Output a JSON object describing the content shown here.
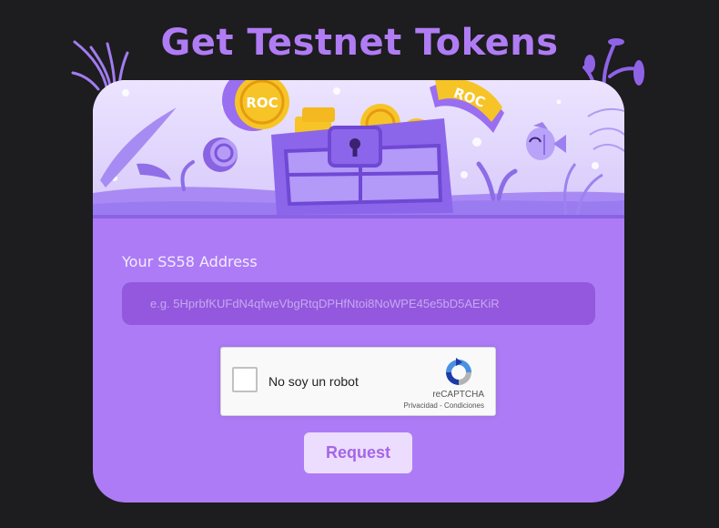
{
  "page": {
    "title": "Get Testnet Tokens"
  },
  "banner": {
    "coin_label": "ROC",
    "ribbon_label": "ROC"
  },
  "form": {
    "address_label": "Your SS58 Address",
    "address_placeholder": "e.g. 5HprbfKUFdN4qfweVbgRtqDPHfNtoi8NoWPE45e5bD5AEKiR",
    "address_value": ""
  },
  "captcha": {
    "checkbox_label": "No soy un robot",
    "brand": "reCAPTCHA",
    "privacy_link": "Privacidad",
    "separator": " - ",
    "terms_link": "Condiciones",
    "checked": false
  },
  "actions": {
    "request_label": "Request"
  },
  "colors": {
    "background": "#1d1c1f",
    "accent": "#ad7bf6",
    "title": "#b07cf4",
    "input_bg": "#9358dd",
    "button_bg": "#ecdcfd",
    "button_text": "#a466e8",
    "coin": "#f6c427"
  },
  "icons": [
    "seaweed-icon",
    "coral-icon",
    "treasure-chest-icon",
    "coin-icon",
    "fish-icon",
    "recaptcha-icon"
  ]
}
